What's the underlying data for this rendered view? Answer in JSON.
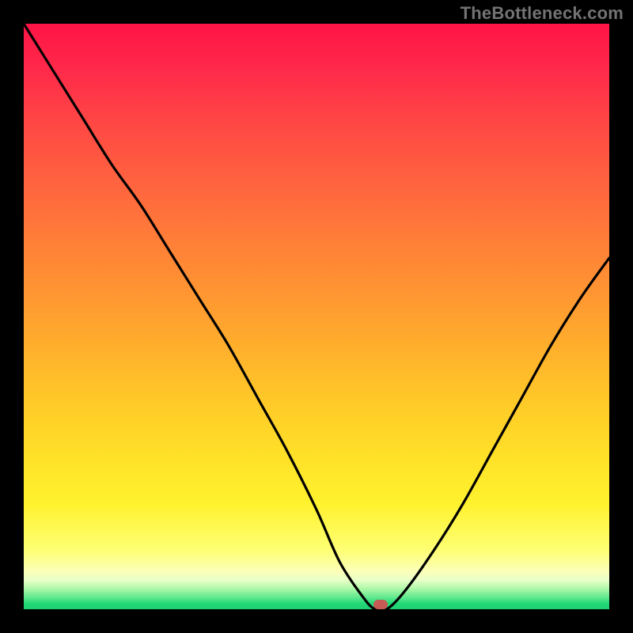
{
  "watermark": "TheBottleneck.com",
  "chart_data": {
    "type": "line",
    "title": "",
    "xlabel": "",
    "ylabel": "",
    "xlim": [
      0,
      100
    ],
    "ylim": [
      0,
      100
    ],
    "grid": false,
    "legend": false,
    "background_gradient": {
      "direction": "vertical",
      "stops": [
        {
          "pos": 0.0,
          "color": "#ff1446"
        },
        {
          "pos": 0.3,
          "color": "#ff6b3d"
        },
        {
          "pos": 0.55,
          "color": "#ffab2d"
        },
        {
          "pos": 0.8,
          "color": "#ffe128"
        },
        {
          "pos": 0.93,
          "color": "#fcffb8"
        },
        {
          "pos": 1.0,
          "color": "#1fd072"
        }
      ]
    },
    "series": [
      {
        "name": "bottleneck-curve",
        "color": "#000000",
        "x": [
          0,
          5,
          10,
          15,
          20,
          25,
          30,
          35,
          40,
          45,
          50,
          54,
          58,
          60,
          62,
          65,
          70,
          75,
          80,
          85,
          90,
          95,
          100
        ],
        "y": [
          100,
          92,
          84,
          76,
          69,
          61,
          53,
          45,
          36,
          27,
          17,
          8,
          2,
          0,
          0,
          3,
          10,
          18,
          27,
          36,
          45,
          53,
          60
        ]
      }
    ],
    "markers": [
      {
        "name": "optimal-point",
        "shape": "pill",
        "color": "#c65a54",
        "x": 61,
        "y": 0
      }
    ]
  }
}
